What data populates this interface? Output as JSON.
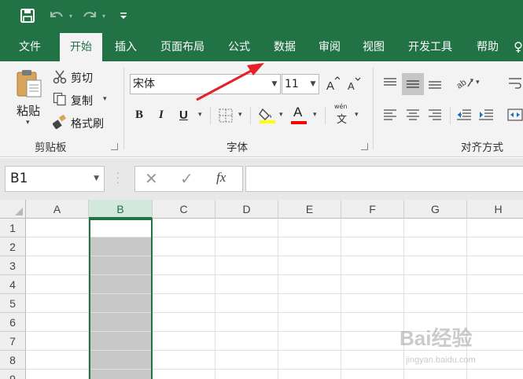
{
  "ribbon_tabs": [
    "文件",
    "开始",
    "插入",
    "页面布局",
    "公式",
    "数据",
    "审阅",
    "视图",
    "开发工具",
    "帮助"
  ],
  "active_tab": "开始",
  "clipboard": {
    "paste_label": "粘贴",
    "cut_label": "剪切",
    "copy_label": "复制",
    "format_painter_label": "格式刷",
    "group_label": "剪贴板"
  },
  "font": {
    "font_name": "宋体",
    "font_size": "11",
    "bold": "B",
    "italic": "I",
    "underline": "U",
    "font_color_letter": "A",
    "phonetic_top": "wén",
    "phonetic_char": "文",
    "group_label": "字体"
  },
  "alignment": {
    "group_label": "对齐方式"
  },
  "formula_bar": {
    "name_box": "B1",
    "fx": "fx",
    "content": ""
  },
  "columns": [
    "A",
    "B",
    "C",
    "D",
    "E",
    "F",
    "G",
    "H"
  ],
  "rows": [
    "1",
    "2",
    "3",
    "4",
    "5",
    "6",
    "7",
    "8",
    "9"
  ],
  "selected_column": "B",
  "watermark": {
    "main": "Bai经验",
    "url": "jingyan.baidu.com"
  },
  "colors": {
    "excel_green": "#217346",
    "fill_yellow": "#ffff00",
    "font_red": "#ff0000",
    "selection_gray": "#c8c8c8",
    "annotation_red": "#e8202a"
  }
}
